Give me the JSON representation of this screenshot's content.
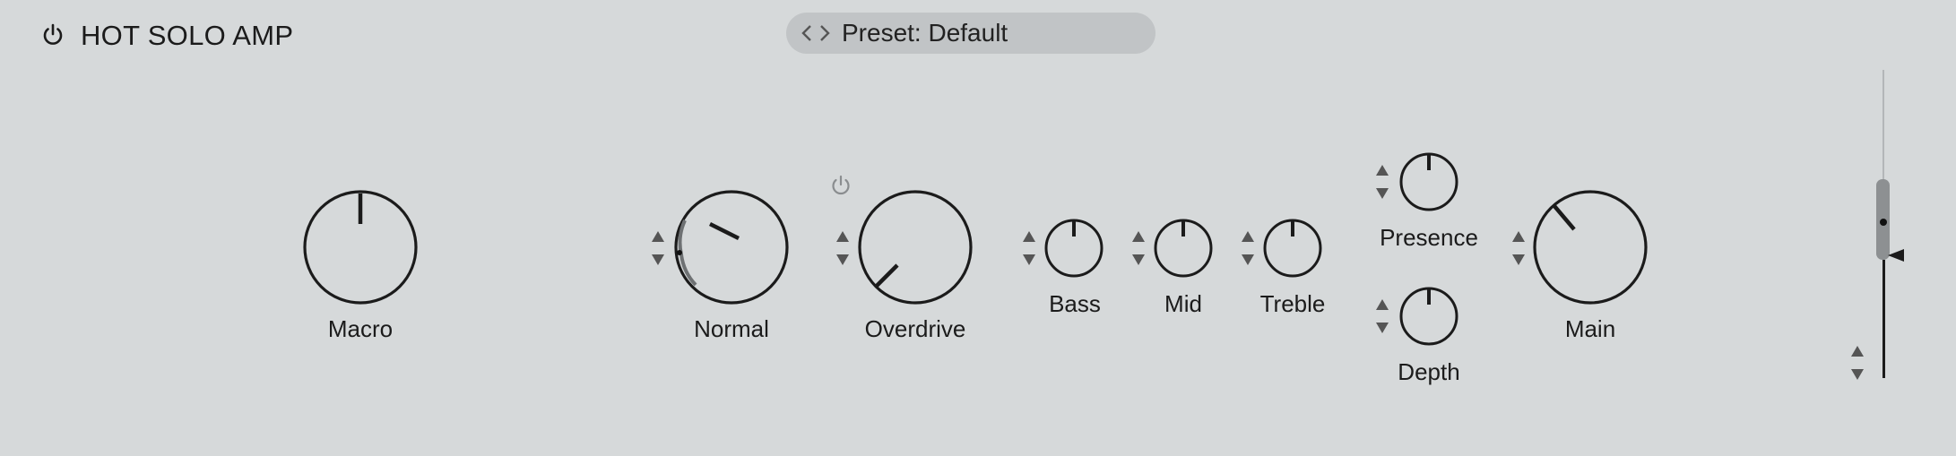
{
  "header": {
    "title": "HOT SOLO AMP",
    "power_icon": "power-icon"
  },
  "preset": {
    "label": "Preset: Default",
    "prev_icon": "chevron-left-icon",
    "next_icon": "chevron-right-icon"
  },
  "knobs": {
    "macro": {
      "label": "Macro"
    },
    "normal": {
      "label": "Normal"
    },
    "overdrive": {
      "label": "Overdrive"
    },
    "bass": {
      "label": "Bass"
    },
    "mid": {
      "label": "Mid"
    },
    "treble": {
      "label": "Treble"
    },
    "presence": {
      "label": "Presence"
    },
    "depth": {
      "label": "Depth"
    },
    "main": {
      "label": "Main"
    }
  },
  "icons": {
    "stepper": "up-down-arrows-icon",
    "overdrive_power": "power-icon",
    "meter_pointer": "triangle-left-icon"
  },
  "colors": {
    "background": "#d6d9da",
    "knob_stroke": "#1b1b1b",
    "preset_bar": "#c1c4c6",
    "muted_icon": "#8a8d8f"
  }
}
